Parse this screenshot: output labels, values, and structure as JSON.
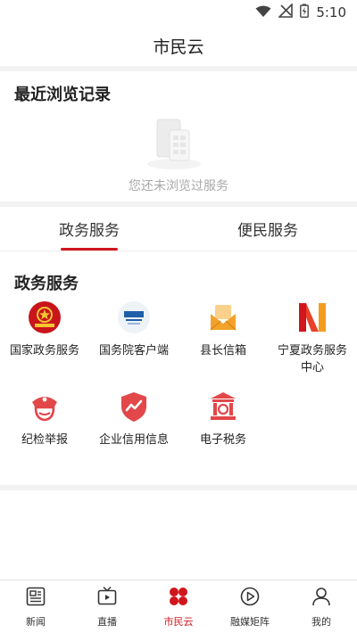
{
  "status_bar": {
    "time": "5:10",
    "icons": [
      "wifi-icon",
      "signal-off-icon",
      "battery-charging-icon"
    ]
  },
  "header": {
    "title": "市民云"
  },
  "recent": {
    "title": "最近浏览记录",
    "empty_text": "您还未浏览过服务"
  },
  "tabs": [
    {
      "label": "政务服务",
      "active": true
    },
    {
      "label": "便民服务",
      "active": false
    }
  ],
  "section": {
    "title": "政务服务"
  },
  "services": [
    {
      "label": "国家政务服务",
      "icon": "national-emblem-icon"
    },
    {
      "label": "国务院客户端",
      "icon": "state-council-icon"
    },
    {
      "label": "县长信箱",
      "icon": "mailbox-icon"
    },
    {
      "label": "宁夏政务服务中心",
      "icon": "ningxia-n-logo-icon"
    },
    {
      "label": "纪检举报",
      "icon": "inspector-cap-icon"
    },
    {
      "label": "企业信用信息",
      "icon": "credit-shield-icon"
    },
    {
      "label": "电子税务",
      "icon": "tax-bureau-icon"
    }
  ],
  "bottom_nav": [
    {
      "label": "新闻",
      "icon": "newspaper-icon",
      "active": false
    },
    {
      "label": "直播",
      "icon": "tv-icon",
      "active": false
    },
    {
      "label": "市民云",
      "icon": "clover-icon",
      "active": true
    },
    {
      "label": "融媒矩阵",
      "icon": "media-matrix-icon",
      "active": false
    },
    {
      "label": "我的",
      "icon": "person-icon",
      "active": false
    }
  ],
  "colors": {
    "accent": "#d0161c",
    "orange": "#f2a22b",
    "muted_text": "#a8a8a8"
  }
}
